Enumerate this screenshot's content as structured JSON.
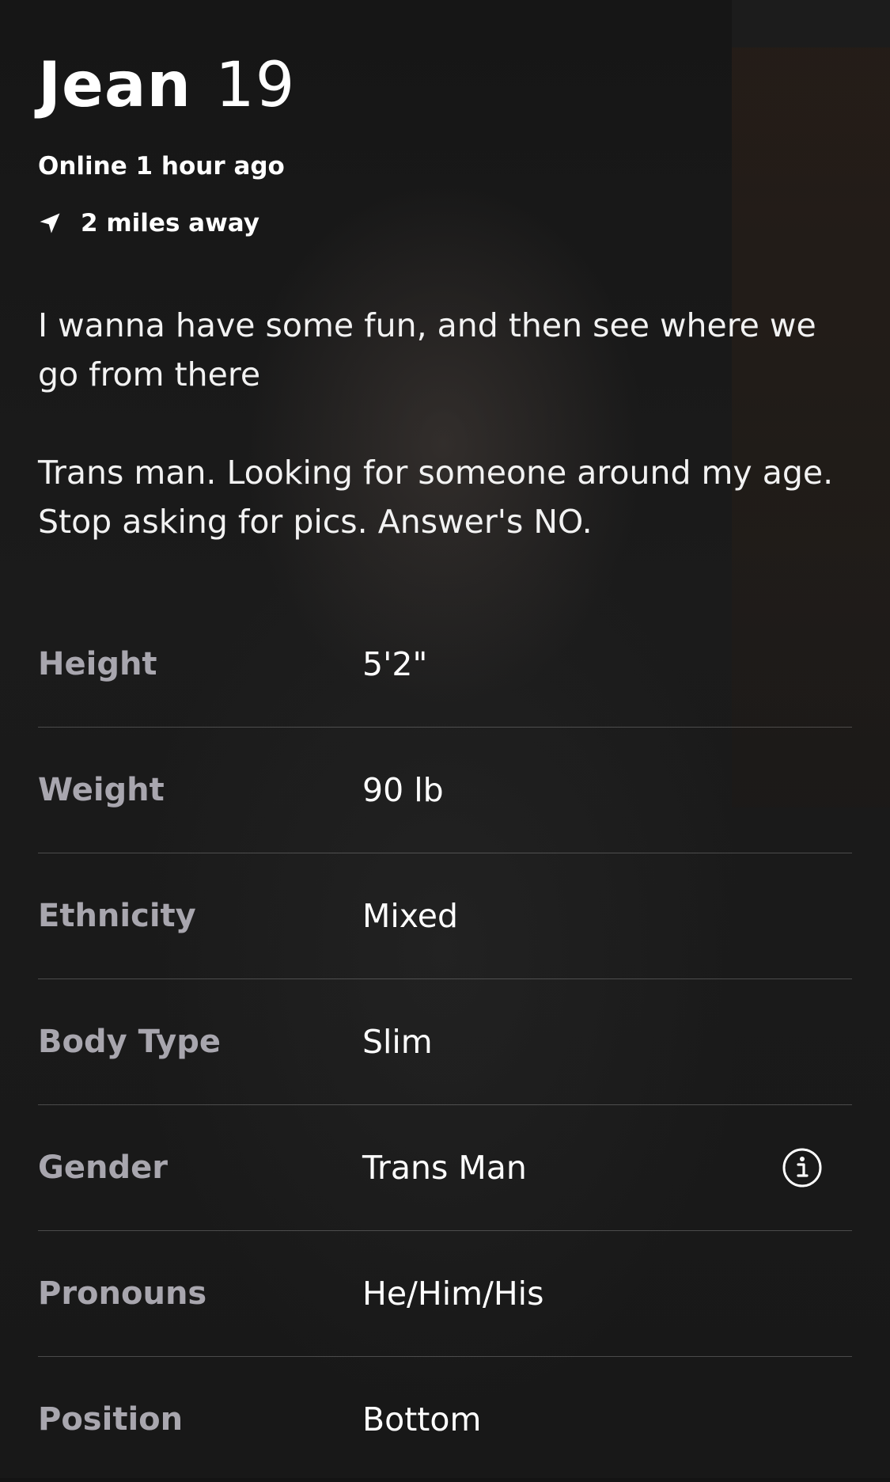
{
  "profile": {
    "name": "Jean",
    "age": "19",
    "online_status": "Online 1 hour ago",
    "distance": "2 miles away",
    "bio": [
      "I wanna have some fun, and then see where we go from there",
      "Trans man. Looking for someone around my age. Stop asking for pics. Answer's NO."
    ]
  },
  "stats": [
    {
      "label": "Height",
      "value": "5'2\""
    },
    {
      "label": "Weight",
      "value": "90 lb"
    },
    {
      "label": "Ethnicity",
      "value": "Mixed"
    },
    {
      "label": "Body Type",
      "value": "Slim"
    },
    {
      "label": "Gender",
      "value": "Trans Man"
    },
    {
      "label": "Pronouns",
      "value": "He/Him/His"
    },
    {
      "label": "Position",
      "value": "Bottom"
    }
  ],
  "icons": {
    "location": "location-arrow-icon",
    "gender_info": "info-icon"
  },
  "colors": {
    "background": "#161616",
    "text_primary": "#ffffff",
    "label_gray": "#a8a6ae",
    "divider": "rgba(255,255,255,0.22)"
  }
}
